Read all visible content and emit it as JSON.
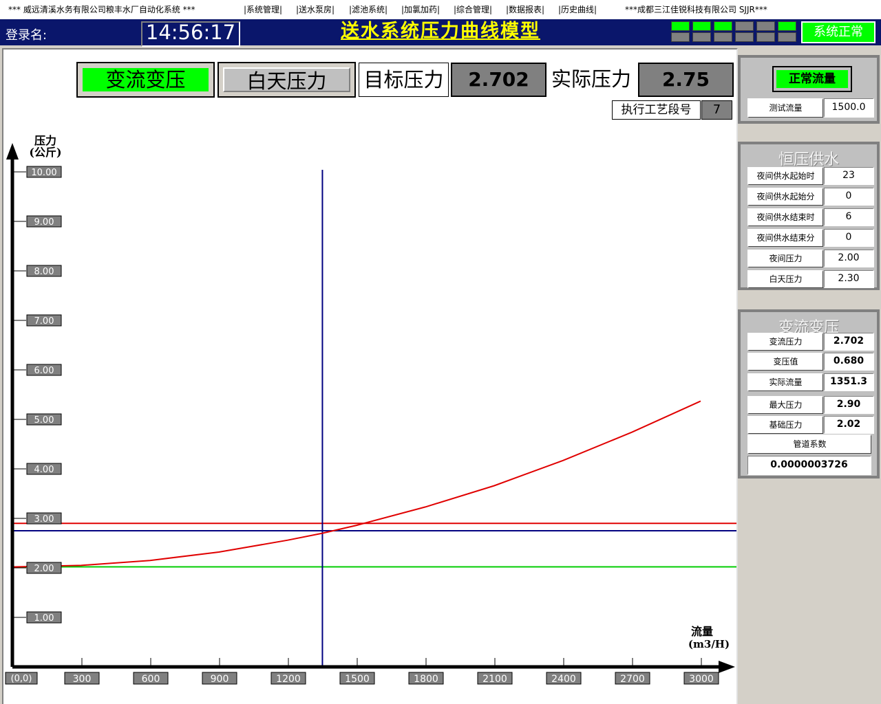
{
  "menubar": {
    "company": "*** 威远清溪水务有限公司粮丰水厂自动化系统 ***",
    "menus": [
      "|系统管理|",
      "|送水泵房|",
      "|滤池系统|",
      "|加氯加药|",
      "|综合管理|",
      "|数据报表|",
      "|历史曲线|"
    ],
    "vendor": "***成都三江佳锐科技有限公司 SJJR***"
  },
  "header": {
    "login_label": "登录名:",
    "clock": "14:56:17",
    "title": "送水系统压力曲线模型",
    "leds": [
      [
        "#00ff00",
        "#00ff00",
        "#00ff00",
        "#808080",
        "#808080",
        "#00ff00"
      ],
      [
        "#808080",
        "#808080",
        "#808080",
        "#808080",
        "#808080",
        "#808080"
      ]
    ],
    "status": "系统正常",
    "status_color": "#00ff00"
  },
  "controls": {
    "mode": "变流变压",
    "period": "白天压力",
    "target_label": "目标压力",
    "target_value": "2.702",
    "actual_label": "实际压力",
    "actual_value": "2.75",
    "step_label": "执行工艺段号",
    "step_value": "7"
  },
  "flow_panel": {
    "button": "正常流量",
    "test_flow_label": "测试流量",
    "test_flow_value": "1500.0"
  },
  "constant_panel": {
    "title": "恒压供水",
    "rows": [
      {
        "label": "夜间供水起始时",
        "value": "23"
      },
      {
        "label": "夜间供水起始分",
        "value": "0"
      },
      {
        "label": "夜间供水结束时",
        "value": "6"
      },
      {
        "label": "夜间供水结束分",
        "value": "0"
      },
      {
        "label": "夜间压力",
        "value": "2.00"
      },
      {
        "label": "白天压力",
        "value": "2.30"
      }
    ]
  },
  "variable_panel": {
    "title": "变流变压",
    "rows": [
      {
        "label": "变流压力",
        "value": "2.702"
      },
      {
        "label": "变压值",
        "value": "0.680"
      },
      {
        "label": "实际流量",
        "value": "1351.3"
      },
      {
        "label": "最大压力",
        "value": "2.90"
      },
      {
        "label": "基础压力",
        "value": "2.02"
      }
    ],
    "pipe_label": "管道系数",
    "pipe_value": "0.0000003726"
  },
  "chart_data": {
    "type": "line",
    "ylabel": "压力\n(公斤)",
    "xlabel": "流量\n(m3/H)",
    "origin_label": "(0,0)",
    "ylim": [
      0,
      10
    ],
    "xlim": [
      0,
      3000
    ],
    "y_ticks": [
      "1.00",
      "2.00",
      "3.00",
      "4.00",
      "5.00",
      "6.00",
      "7.00",
      "8.00",
      "9.00",
      "10.00"
    ],
    "x_ticks": [
      "300",
      "600",
      "900",
      "1200",
      "1500",
      "1800",
      "2100",
      "2400",
      "2700",
      "3000"
    ],
    "curve": {
      "color": "#e00000",
      "base_pressure": 2.02,
      "coefficient": 3.726e-07,
      "x": [
        0,
        300,
        600,
        900,
        1200,
        1351.3,
        1500,
        1800,
        2100,
        2400,
        2700,
        3000
      ],
      "y": [
        2.02,
        2.05,
        2.15,
        2.32,
        2.56,
        2.7,
        2.86,
        3.23,
        3.66,
        4.17,
        4.74,
        5.37
      ]
    },
    "hlines": [
      {
        "y": 2.9,
        "color": "#e00000"
      },
      {
        "y": 2.75,
        "color": "#000080"
      },
      {
        "y": 2.02,
        "color": "#00cc00"
      }
    ],
    "vline": {
      "x": 1351.3,
      "color": "#000080"
    }
  }
}
